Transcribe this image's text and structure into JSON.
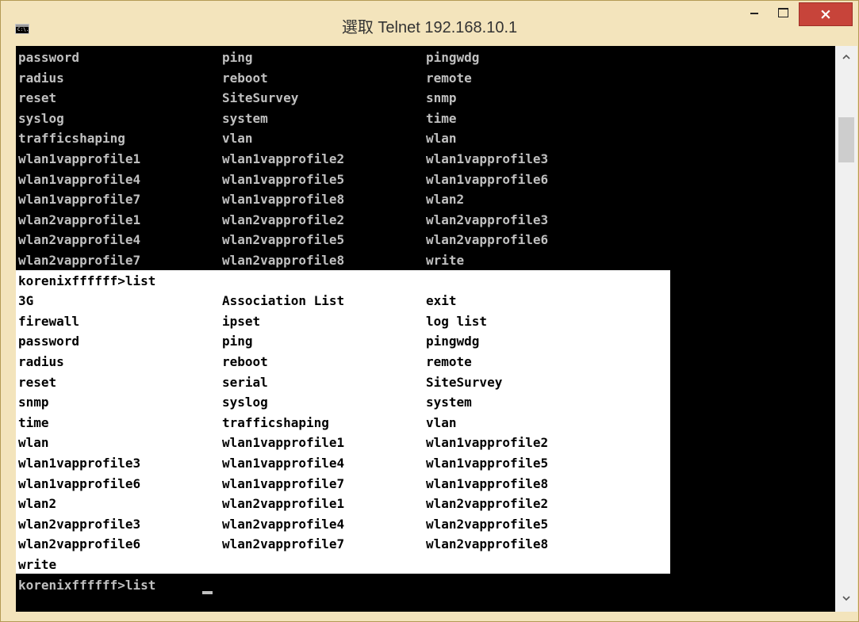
{
  "window": {
    "title": "選取 Telnet 192.168.10.1",
    "close_label": "×"
  },
  "app_icon": "C:\\.",
  "icons": [
    "console-app-icon",
    "minimize-icon",
    "maximize-icon",
    "close-icon",
    "chevron-up-icon",
    "chevron-down-icon"
  ],
  "colors": {
    "selection": "#ffffff",
    "console_bg": "#000000",
    "console_fg": "#c0c0c0",
    "selected_fg": "#000000",
    "close_button": "#c7443a",
    "frame": "#f3e4bc"
  },
  "console": {
    "lines": [
      {
        "cols": [
          "password",
          "ping",
          "pingwdg"
        ]
      },
      {
        "cols": [
          "radius",
          "reboot",
          "remote"
        ]
      },
      {
        "cols": [
          "reset",
          "SiteSurvey",
          "snmp"
        ]
      },
      {
        "cols": [
          "syslog",
          "system",
          "time"
        ]
      },
      {
        "cols": [
          "trafficshaping",
          "vlan",
          "wlan"
        ]
      },
      {
        "cols": [
          "wlan1vapprofile1",
          "wlan1vapprofile2",
          "wlan1vapprofile3"
        ]
      },
      {
        "cols": [
          "wlan1vapprofile4",
          "wlan1vapprofile5",
          "wlan1vapprofile6"
        ]
      },
      {
        "cols": [
          "wlan1vapprofile7",
          "wlan1vapprofile8",
          "wlan2"
        ]
      },
      {
        "cols": [
          "wlan2vapprofile1",
          "wlan2vapprofile2",
          "wlan2vapprofile3"
        ]
      },
      {
        "cols": [
          "wlan2vapprofile4",
          "wlan2vapprofile5",
          "wlan2vapprofile6"
        ]
      },
      {
        "cols": [
          "wlan2vapprofile7",
          "wlan2vapprofile8",
          "write"
        ]
      },
      {
        "cols": [
          "korenixffffff>list",
          "",
          ""
        ],
        "selected": true
      },
      {
        "cols": [
          "3G",
          "Association List",
          "exit"
        ],
        "selected": true
      },
      {
        "cols": [
          "firewall",
          "ipset",
          "log list"
        ],
        "selected": true
      },
      {
        "cols": [
          "password",
          "ping",
          "pingwdg"
        ],
        "selected": true
      },
      {
        "cols": [
          "radius",
          "reboot",
          "remote"
        ],
        "selected": true
      },
      {
        "cols": [
          "reset",
          "serial",
          "SiteSurvey"
        ],
        "selected": true
      },
      {
        "cols": [
          "snmp",
          "syslog",
          "system"
        ],
        "selected": true
      },
      {
        "cols": [
          "time",
          "trafficshaping",
          "vlan"
        ],
        "selected": true
      },
      {
        "cols": [
          "wlan",
          "wlan1vapprofile1",
          "wlan1vapprofile2"
        ],
        "selected": true
      },
      {
        "cols": [
          "wlan1vapprofile3",
          "wlan1vapprofile4",
          "wlan1vapprofile5"
        ],
        "selected": true
      },
      {
        "cols": [
          "wlan1vapprofile6",
          "wlan1vapprofile7",
          "wlan1vapprofile8"
        ],
        "selected": true
      },
      {
        "cols": [
          "wlan2",
          "wlan2vapprofile1",
          "wlan2vapprofile2"
        ],
        "selected": true
      },
      {
        "cols": [
          "wlan2vapprofile3",
          "wlan2vapprofile4",
          "wlan2vapprofile5"
        ],
        "selected": true
      },
      {
        "cols": [
          "wlan2vapprofile6",
          "wlan2vapprofile7",
          "wlan2vapprofile8"
        ],
        "selected": true
      },
      {
        "cols": [
          "write",
          "",
          ""
        ],
        "selected": true
      },
      {
        "cols": [
          "korenixffffff>list",
          "",
          ""
        ],
        "cursor": true
      }
    ]
  }
}
